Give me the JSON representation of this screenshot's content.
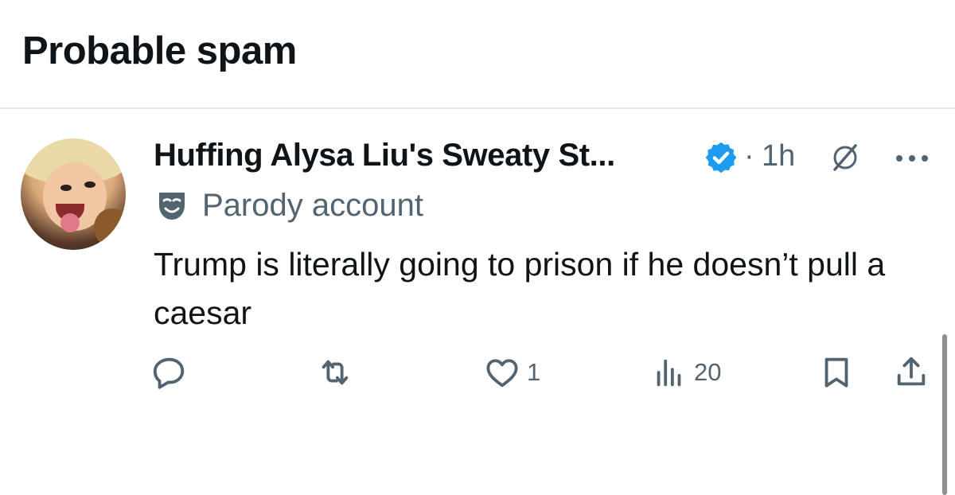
{
  "header": {
    "title": "Probable spam"
  },
  "tweet": {
    "display_name": "Huffing Alysa Liu's Sweaty St...",
    "separator": "·",
    "time": "1h",
    "label": "Parody account",
    "text": "Trump is literally going to prison if he doesn’t pull a caesar",
    "actions": {
      "reply_count": "",
      "repost_count": "",
      "like_count": "1",
      "view_count": "20"
    }
  },
  "colors": {
    "text_primary": "#0f1419",
    "text_secondary": "#536471",
    "verified_blue": "#1d9bf0",
    "divider": "#e6e9ec"
  },
  "icons": {
    "verified": "verified-badge-icon",
    "grok": "grok-icon",
    "more": "more-icon",
    "parody": "theater-mask-icon",
    "reply": "reply-icon",
    "repost": "repost-icon",
    "like": "heart-icon",
    "views": "analytics-icon",
    "bookmark": "bookmark-icon",
    "share": "share-icon"
  }
}
